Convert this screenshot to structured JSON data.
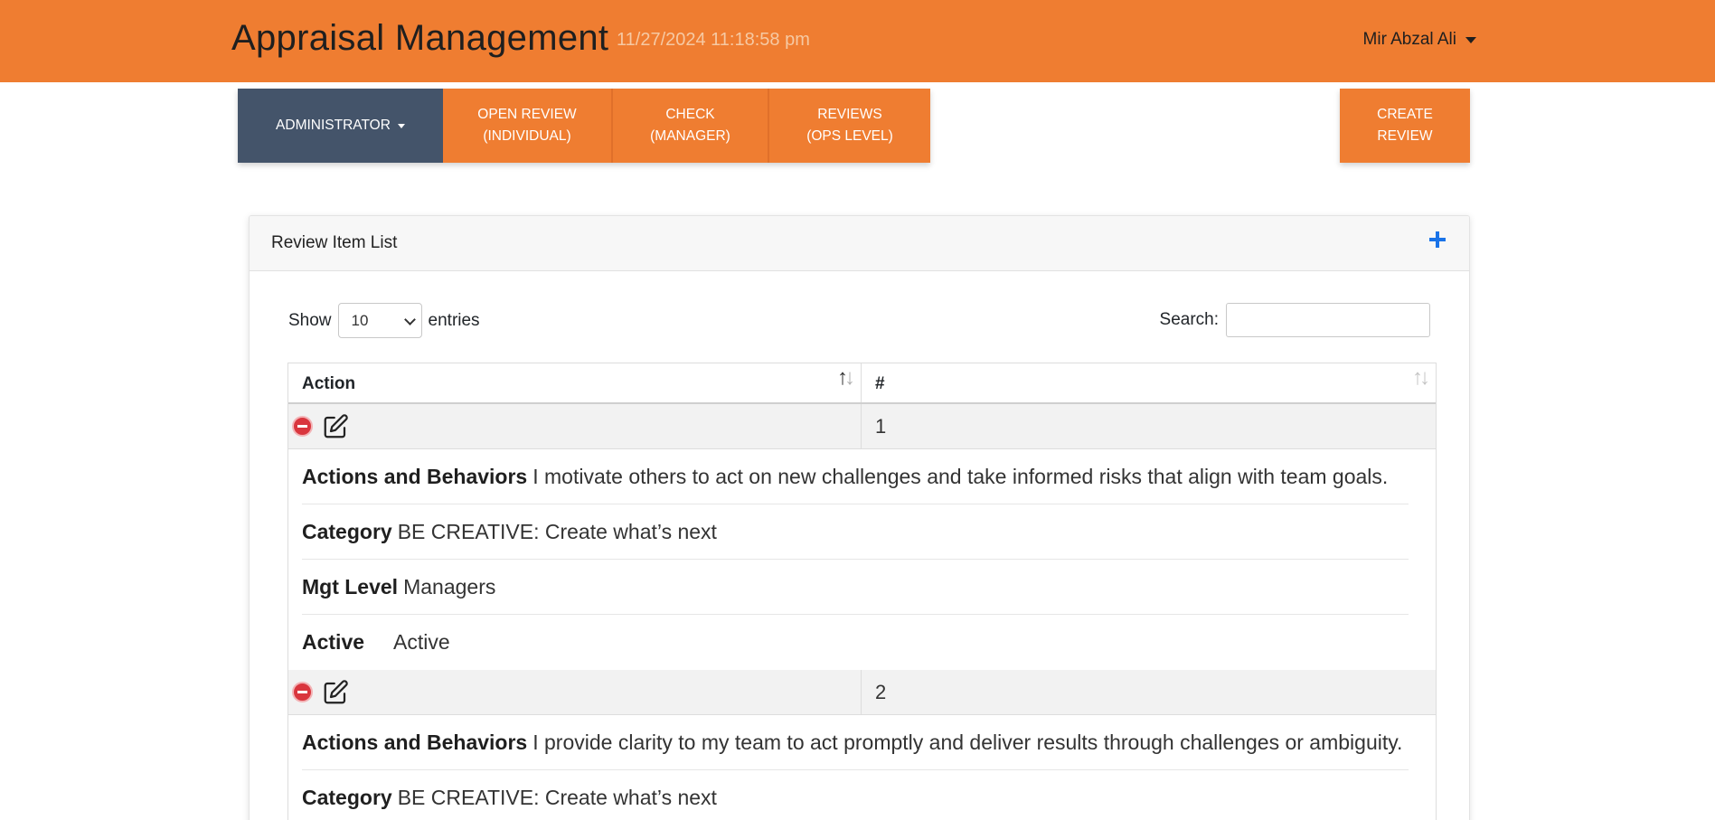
{
  "header": {
    "title": "Appraisal Management",
    "datetime": "11/27/2024 11:18:58 pm",
    "user": "Mir Abzal Ali"
  },
  "nav": {
    "admin": "ADMINISTRATOR",
    "open_review": [
      "OPEN REVIEW",
      "(INDIVIDUAL)"
    ],
    "check": [
      "CHECK",
      "(MANAGER)"
    ],
    "reviews": [
      "REVIEWS",
      "(OPS LEVEL)"
    ],
    "create": [
      "CREATE",
      "REVIEW"
    ]
  },
  "card": {
    "title": "Review Item List"
  },
  "table_controls": {
    "show_label": "Show",
    "entries_value": "10",
    "entries_label": "entries",
    "search_label": "Search:",
    "search_value": ""
  },
  "table": {
    "columns": [
      "Action",
      "#"
    ],
    "rows": [
      {
        "number": "1",
        "details": [
          {
            "label": "Actions and Behaviors",
            "value": "I motivate others to act on new challenges and take informed risks that align with team goals."
          },
          {
            "label": "Category",
            "value": "BE CREATIVE: Create what’s next"
          },
          {
            "label": "Mgt Level",
            "value": "Managers"
          },
          {
            "label": "Active",
            "value": "Active"
          }
        ]
      },
      {
        "number": "2",
        "details": [
          {
            "label": "Actions and Behaviors",
            "value": "I provide clarity to my team to act promptly and deliver results through challenges or ambiguity."
          },
          {
            "label": "Category",
            "value": "BE CREATIVE: Create what’s next"
          }
        ]
      }
    ]
  },
  "icons": {
    "user_caret": "chevron-down-icon",
    "add": "plus-icon",
    "remove": "minus-circle-icon",
    "edit": "edit-icon",
    "sort": "sort-icon"
  },
  "colors": {
    "brand_orange": "#ef7d31",
    "admin_slate": "#44546a",
    "add_blue": "#1a73e8",
    "remove_red": "#d9363e"
  }
}
